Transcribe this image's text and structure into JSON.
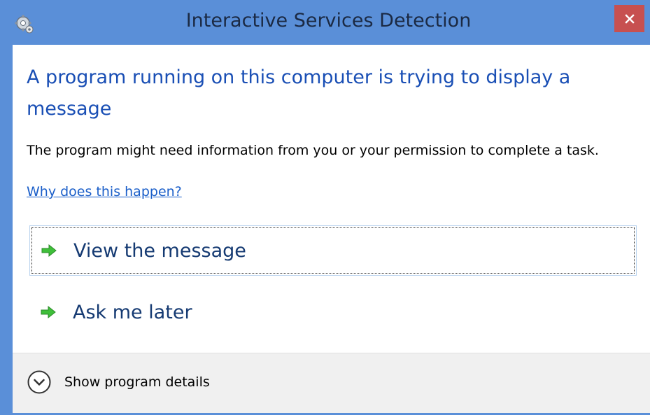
{
  "window": {
    "title": "Interactive Services Detection",
    "titlebar_color": "#5a8fd8",
    "close_button_color": "#c75050",
    "close_glyph": "✕"
  },
  "main": {
    "heading": "A program running on this computer is trying to display a message",
    "description": "The program might need information from you or your permission to complete a task.",
    "help_link": "Why does this happen?",
    "heading_color": "#1a4fb5",
    "link_color": "#1a5ec9"
  },
  "commands": [
    {
      "label": "View the message",
      "icon": "green-arrow-icon",
      "focused": true
    },
    {
      "label": "Ask me later",
      "icon": "green-arrow-icon",
      "focused": false
    }
  ],
  "footer": {
    "expand_label": "Show program details",
    "expand_icon": "chevron-down-circle-icon"
  }
}
